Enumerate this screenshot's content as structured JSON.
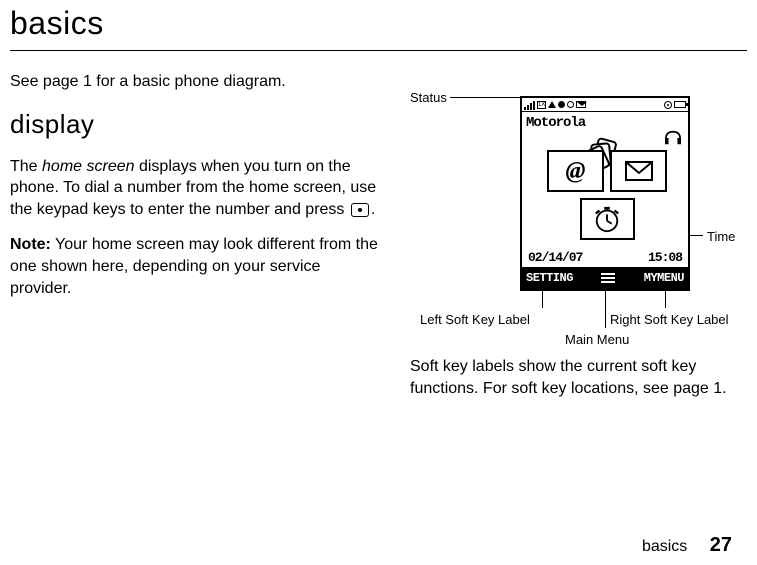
{
  "page_title": "basics",
  "intro": "See page 1 for a basic phone diagram.",
  "section_title": "display",
  "body_1a": "The ",
  "body_1_italic": "home screen",
  "body_1b": " displays when you turn on the phone. To dial a number from the home screen, use the keypad keys to enter the number and press ",
  "body_1c": ".",
  "note_label": "Note:",
  "note_body": " Your home screen may look different from the one shown here, depending on your service provider.",
  "right_body": "Soft key labels show the current soft key functions. For soft key locations, see page 1.",
  "callouts": {
    "status": "Status",
    "time": "Time",
    "left_soft": "Left Soft Key Label",
    "right_soft": "Right Soft Key Label",
    "main_menu": "Main Menu"
  },
  "phone": {
    "carrier": "Motorola",
    "date": "02/14/07",
    "time": "15:08",
    "left_softkey": "SETTING",
    "right_softkey": "MYMENU",
    "status_1x": "1X"
  },
  "footer_text": "basics",
  "page_number": "27"
}
